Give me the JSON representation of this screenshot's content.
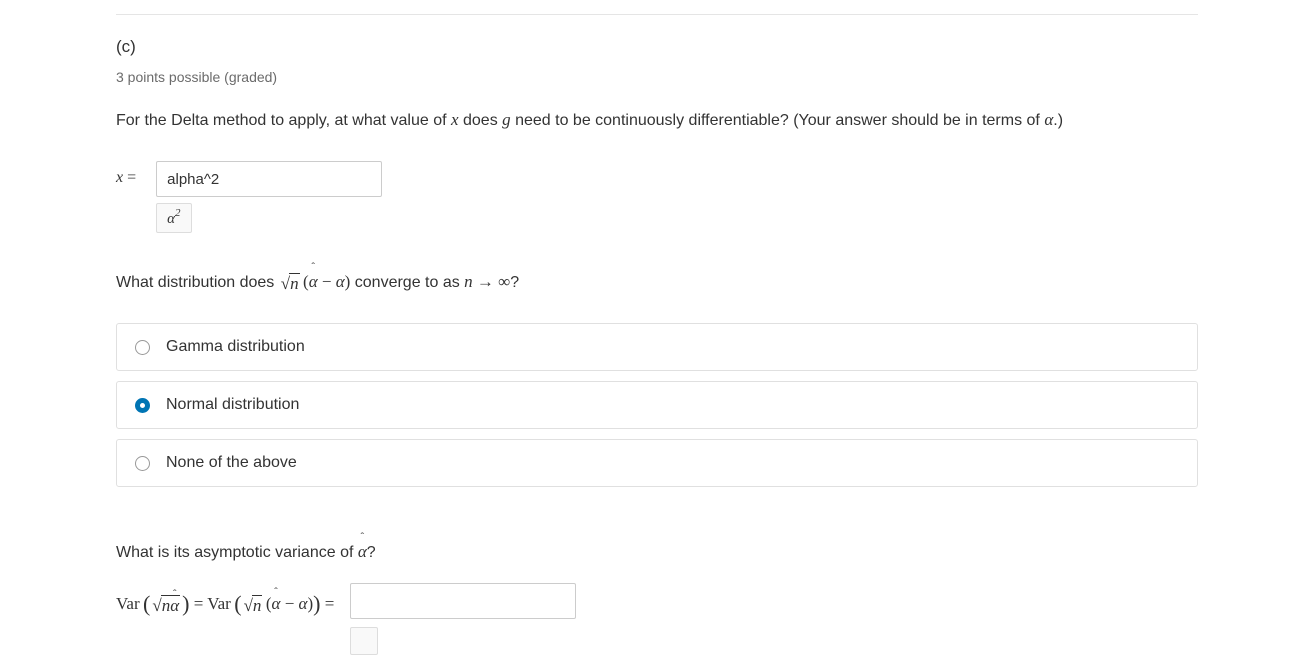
{
  "part": {
    "label": "(c)",
    "points_text": "3 points possible (graded)"
  },
  "q1": {
    "prompt_prefix": "For the Delta method to apply, at what value of ",
    "var_x": "x",
    "prompt_mid1": " does ",
    "var_g": "g",
    "prompt_mid2": " need to be continuously differentiable? (Your answer should be in terms of ",
    "var_alpha": "α",
    "prompt_suffix": ".)",
    "label_prefix": "x",
    "label_eq": " =",
    "input_value": "alpha^2",
    "preview_base": "α",
    "preview_exp": "2"
  },
  "q2": {
    "prompt_prefix": "What distribution does ",
    "expr_sqrt_arg": "n",
    "expr_paren_open": "(",
    "expr_hat_var": "α",
    "expr_hat": "ˆ",
    "expr_minus": " − ",
    "expr_alpha": "α",
    "expr_paren_close": ")",
    "prompt_mid": " converge to as ",
    "expr_n": "n",
    "expr_arrow": " → ∞",
    "prompt_suffix": "?",
    "options": [
      {
        "label": "Gamma distribution",
        "selected": false
      },
      {
        "label": "Normal distribution",
        "selected": true
      },
      {
        "label": "None of the above",
        "selected": false
      }
    ]
  },
  "q3": {
    "prompt_prefix": "What is its asymptotic variance of ",
    "prompt_hat_var": "α",
    "prompt_hat": "ˆ",
    "prompt_suffix": "?",
    "var_word": "Var",
    "paren_open": "(",
    "sqrt_arg1": "n",
    "hat_var1": "α",
    "hat1": "ˆ",
    "paren_close": ")",
    "eq": " = ",
    "sqrt_arg2": "n",
    "inner_paren_open": "(",
    "hat_var2": "α",
    "hat2": "ˆ",
    "minus": " − ",
    "alpha2": "α",
    "inner_paren_close": ")",
    "eq2": " =",
    "input_value": ""
  }
}
